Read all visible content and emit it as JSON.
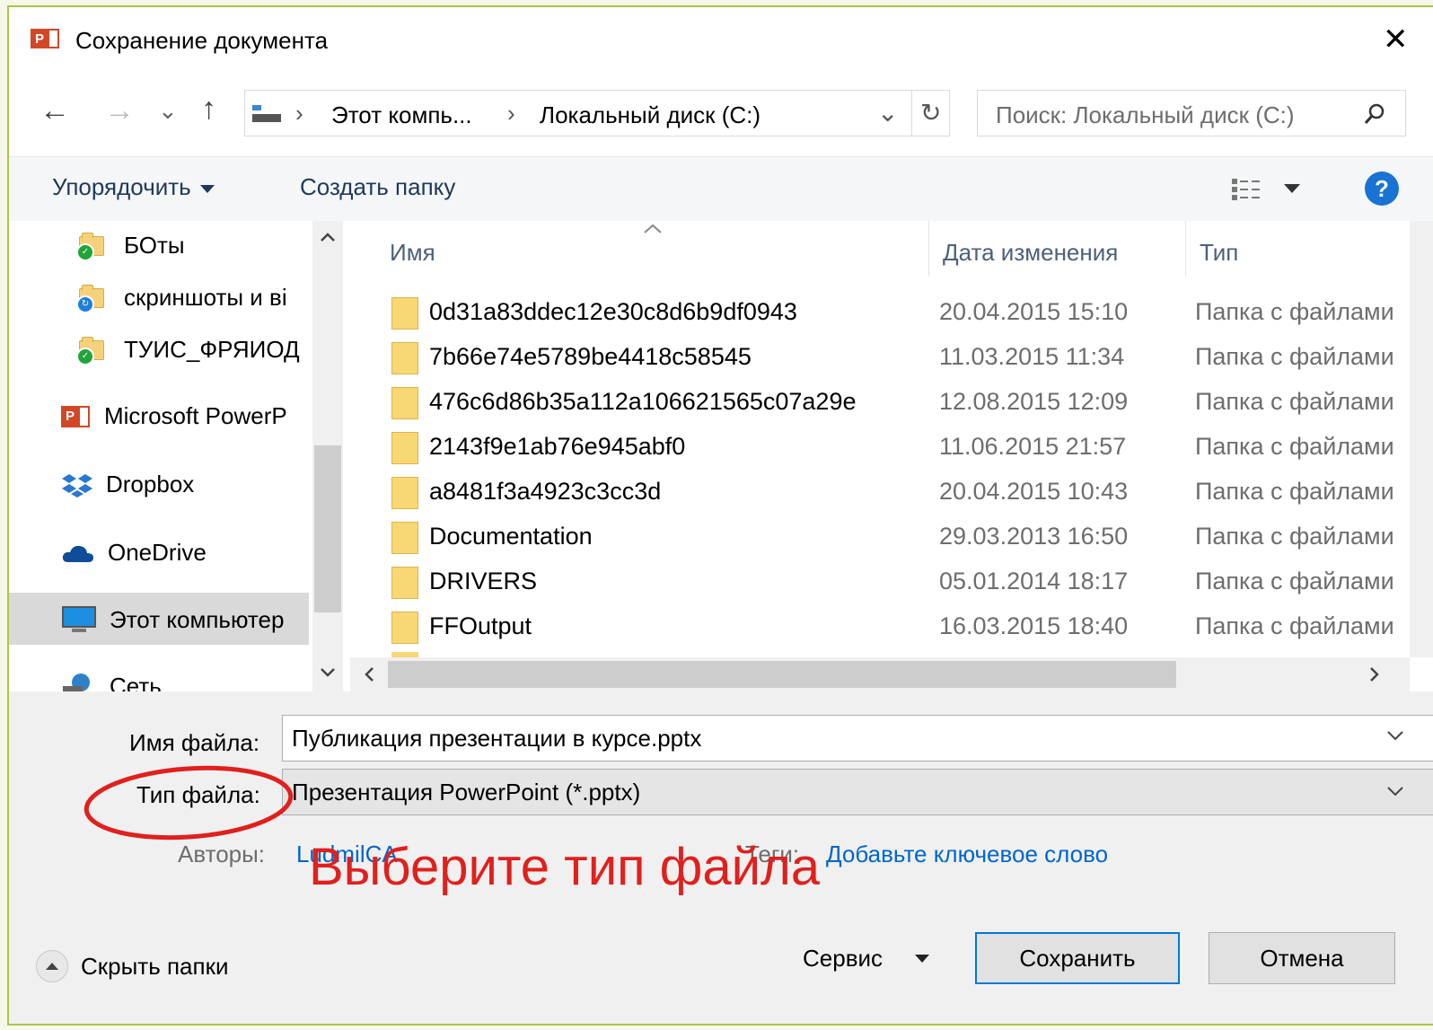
{
  "window": {
    "title": "Сохранение документа",
    "close_symbol": "✕"
  },
  "nav_bar": {
    "back": "←",
    "forward": "→",
    "recent": "⌄",
    "up": "↑",
    "breadcrumb": [
      "Этот компь...",
      "Локальный диск (C:)"
    ],
    "separator": "›",
    "dropdown": "⌄",
    "refresh": "↻",
    "search_placeholder": "Поиск: Локальный диск (C:)"
  },
  "toolbar": {
    "organize_label": "Упорядочить",
    "new_folder_label": "Создать папку",
    "help_symbol": "?"
  },
  "nav_pane": {
    "items": [
      {
        "label": "БОты",
        "icon": "folder-icon"
      },
      {
        "label": "скриншоты и ві",
        "icon": "folder-icon"
      },
      {
        "label": "ТУИС_ФРЯИОД",
        "icon": "folder-icon"
      },
      {
        "label": "Microsoft PowerP",
        "icon": "powerpoint-icon"
      },
      {
        "label": "Dropbox",
        "icon": "dropbox-icon"
      },
      {
        "label": "OneDrive",
        "icon": "onedrive-icon"
      },
      {
        "label": "Этот компьютер",
        "icon": "computer-icon"
      },
      {
        "label": "Сеть",
        "icon": "network-icon"
      }
    ]
  },
  "file_list": {
    "columns": {
      "name": "Имя",
      "date": "Дата изменения",
      "type": "Тип"
    },
    "rows": [
      {
        "name": "0d31a83ddec12e30c8d6b9df0943",
        "date": "20.04.2015 15:10",
        "type": "Папка с файлами"
      },
      {
        "name": "7b66e74e5789be4418c58545",
        "date": "11.03.2015 11:34",
        "type": "Папка с файлами"
      },
      {
        "name": "476c6d86b35a112a106621565c07a29e",
        "date": "12.08.2015 12:09",
        "type": "Папка с файлами"
      },
      {
        "name": "2143f9e1ab76e945abf0",
        "date": "11.06.2015 21:57",
        "type": "Папка с файлами"
      },
      {
        "name": "a8481f3a4923c3cc3d",
        "date": "20.04.2015 10:43",
        "type": "Папка с файлами"
      },
      {
        "name": "Documentation",
        "date": "29.03.2013 16:50",
        "type": "Папка с файлами"
      },
      {
        "name": "DRIVERS",
        "date": "05.01.2014 18:17",
        "type": "Папка с файлами"
      },
      {
        "name": "FFOutput",
        "date": "16.03.2015 18:40",
        "type": "Папка с файлами"
      }
    ]
  },
  "form": {
    "filename_label": "Имя файла:",
    "filename_value": "Публикация презентации в курсе.pptx",
    "filetype_label": "Тип файла:",
    "filetype_value": "Презентация PowerPoint (*.pptx)",
    "authors_label": "Авторы:",
    "authors_value": "LudmilCA",
    "tags_label": "Теги:",
    "tags_value": "Добавьте ключевое слово"
  },
  "annotation": {
    "text": "Выберите тип файла",
    "color": "#e0201d"
  },
  "footer": {
    "hide_folders_label": "Скрыть папки",
    "tools_label": "Сервис",
    "save_label": "Сохранить",
    "cancel_label": "Отмена"
  },
  "colors": {
    "frame_accent": "#a7c64a",
    "primary_button_border": "#0078d7",
    "link": "#0066cc"
  }
}
